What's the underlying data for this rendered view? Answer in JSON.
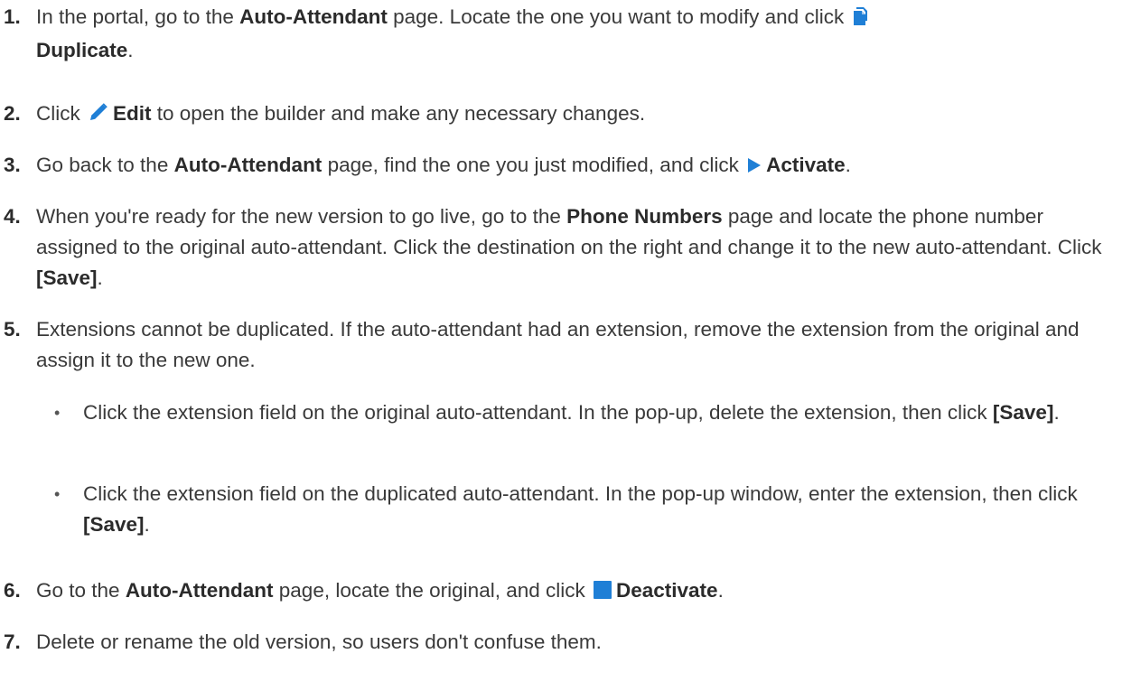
{
  "colors": {
    "icon_blue": "#1f7fd6",
    "text": "#3a3a3a"
  },
  "steps": [
    {
      "num": "1.",
      "a": "In the portal, go to the ",
      "b": "Auto-Attendant",
      "c": " page. Locate the one you want to modify and click ",
      "icon": "duplicate-icon",
      "d": "Duplicate",
      "e": "."
    },
    {
      "num": "2.",
      "a": "Click ",
      "icon": "pencil-icon",
      "b": "Edit",
      "c": " to open the builder and make any necessary changes."
    },
    {
      "num": "3.",
      "a": "Go back to the ",
      "b": "Auto-Attendant",
      "c": " page, find the one you just modified, and click ",
      "icon": "play-icon",
      "d": "Activate",
      "e": "."
    },
    {
      "num": "4.",
      "a": "When you're ready for the new version to go live, go to the ",
      "b": "Phone Numbers",
      "c": " page and locate the phone number assigned to the original auto-attendant. Click the destination on the right and change it to the new auto-attendant. Click ",
      "d": "[Save]",
      "e": "."
    },
    {
      "num": "5.",
      "a": "Extensions cannot be duplicated. If the auto-attendant had an extension, remove the extension from the original and assign it to the new one.",
      "bullets": [
        {
          "bullet": "•",
          "a": "Click the extension field on the original auto-attendant. In the pop-up, delete the extension, then click ",
          "b": "[Save]",
          "c": "."
        },
        {
          "bullet": "•",
          "a": "Click the extension field on the duplicated auto-attendant. In the pop-up window, enter the extension, then click ",
          "b": "[Save]",
          "c": "."
        }
      ]
    },
    {
      "num": "6.",
      "a": "Go to the ",
      "b": "Auto-Attendant",
      "c": " page, locate the original, and click ",
      "icon": "stop-square-icon",
      "d": "Deactivate",
      "e": "."
    },
    {
      "num": "7.",
      "a": "Delete or rename the old version, so users don't confuse them."
    }
  ]
}
